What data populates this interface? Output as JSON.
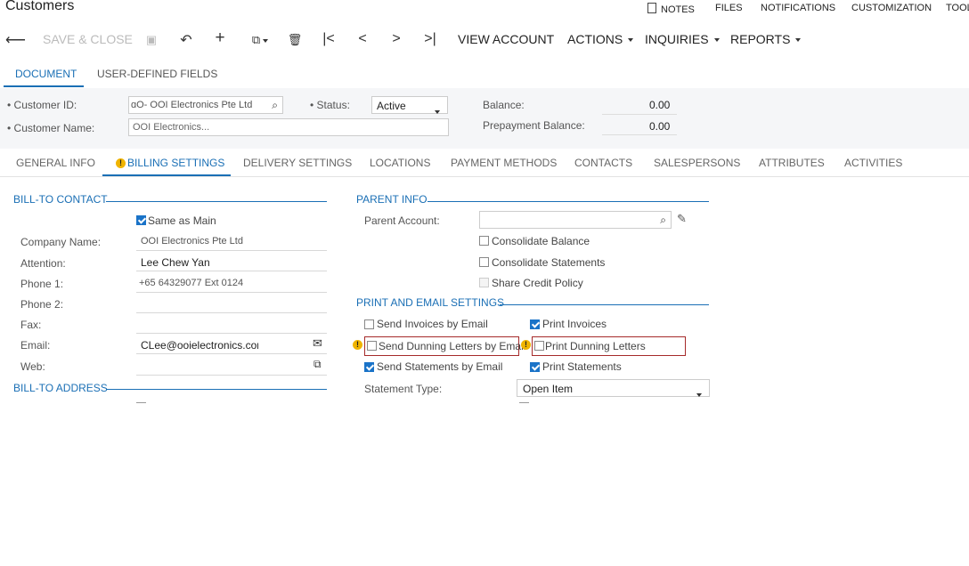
{
  "app": {
    "title": "Customers"
  },
  "top_links": [
    "NOTES",
    "FILES",
    "NOTIFICATIONS",
    "CUSTOMIZATION",
    "TOOL"
  ],
  "toolbar": {
    "save_close": "SAVE & CLOSE",
    "view_account": "VIEW ACCOUNT",
    "actions": "ACTIONS",
    "inquiries": "INQUIRIES",
    "reports": "REPORTS"
  },
  "form_tabs": [
    "DOCUMENT",
    "USER-DEFINED FIELDS"
  ],
  "header": {
    "customer_id_label": "Customer ID:",
    "customer_id_value": "ɑO- OOI Electronics Pte Ltd",
    "status_label": "Status:",
    "status_value": "Active",
    "customer_name_label": "Customer Name:",
    "customer_name_value": "OOI Electronics...",
    "balance_label": "Balance:",
    "balance_value": "0.00",
    "prepayment_label": "Prepayment Balance:",
    "prepayment_value": "0.00"
  },
  "detail_tabs": [
    "GENERAL INFO",
    "BILLING SETTINGS",
    "DELIVERY SETTINGS",
    "LOCATIONS",
    "PAYMENT METHODS",
    "CONTACTS",
    "SALESPERSONS",
    "ATTRIBUTES",
    "ACTIVITIES"
  ],
  "bill_to_contact": {
    "title": "BILL-TO CONTACT",
    "same_as_main": "Same as Main",
    "company_label": "Company Name:",
    "company_value": "OOI Electronics Pte Ltd",
    "attention_label": "Attention:",
    "attention_value": "Lee Chew Yan",
    "phone1_label": "Phone 1:",
    "phone1_value": "+65 64329077 Ext 0124",
    "phone2_label": "Phone 2:",
    "fax_label": "Fax:",
    "email_label": "Email:",
    "email_value": "CLee@ooielectronics.com",
    "web_label": "Web:"
  },
  "bill_to_address": {
    "title": "BILL-TO ADDRESS"
  },
  "parent_info": {
    "title": "PARENT INFO",
    "parent_account_label": "Parent Account:",
    "consolidate_balance": "Consolidate Balance",
    "consolidate_statements": "Consolidate Statements",
    "share_credit": "Share Credit Policy"
  },
  "print_email": {
    "title": "PRINT AND EMAIL SETTINGS",
    "send_invoices": "Send Invoices by Email",
    "print_invoices": "Print Invoices",
    "send_dunning": "Send Dunning Letters by Email",
    "print_dunning": "Print Dunning Letters",
    "send_statements": "Send Statements by Email",
    "print_statements": "Print Statements",
    "statement_type_label": "Statement Type:",
    "statement_type_value": "Open Item"
  },
  "colors": {
    "accent": "#1a6fb5",
    "highlight": "#a52a2a",
    "warning": "#f0b400"
  }
}
